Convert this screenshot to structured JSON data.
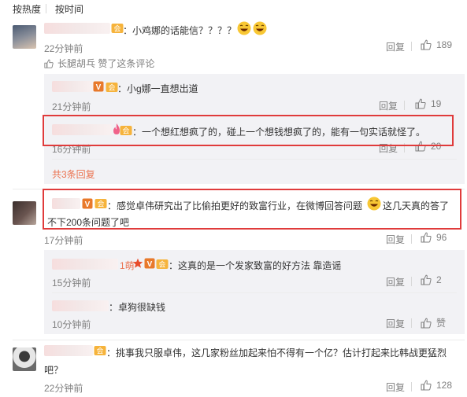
{
  "sort": {
    "hot": "按热度",
    "time": "按时间"
  },
  "comments": [
    {
      "text": "：小鸡娜的话能信？？？？",
      "time": "22分钟前",
      "reply": "回复",
      "likes": "189",
      "liked_by": "长腿胡乓 赞了这条评论",
      "replies": [
        {
          "text": "：小g娜一直想出道",
          "time": "21分钟前",
          "reply": "回复",
          "likes": "19"
        },
        {
          "text": "：一个想红想疯了的，碰上一个想钱想疯了的，能有一句实话就怪了。",
          "time": "16分钟前",
          "reply": "回复",
          "likes": "20"
        }
      ],
      "more": "共3条回复"
    },
    {
      "text_1": "：感觉卓伟研究出了比偷拍更好的致富行业，在微博回答问题",
      "text_2": "这几天真的答了",
      "text_3": "不下200条问题了吧",
      "time": "17分钟前",
      "reply": "回复",
      "likes": "96",
      "replies": [
        {
          "name_tail": "1萌",
          "text": "：这真的是一个发家致富的好方法 靠造谣",
          "time": "15分钟前",
          "reply": "回复",
          "likes": "2"
        },
        {
          "text": "：卓狗很缺钱",
          "time": "10分钟前",
          "reply": "回复",
          "likes": "赞"
        }
      ]
    },
    {
      "text_1": "：挑事我只服卓伟，这几家粉丝加起来怕不得有一个亿？估计打起来比韩战更猛烈",
      "text_2": "吧？",
      "time": "22分钟前",
      "reply": "回复",
      "likes": "128"
    }
  ],
  "colors": {
    "highlight": "#e03b3b",
    "link": "#eb7350",
    "muted": "#808080",
    "sub_bg": "#f2f2f5"
  }
}
